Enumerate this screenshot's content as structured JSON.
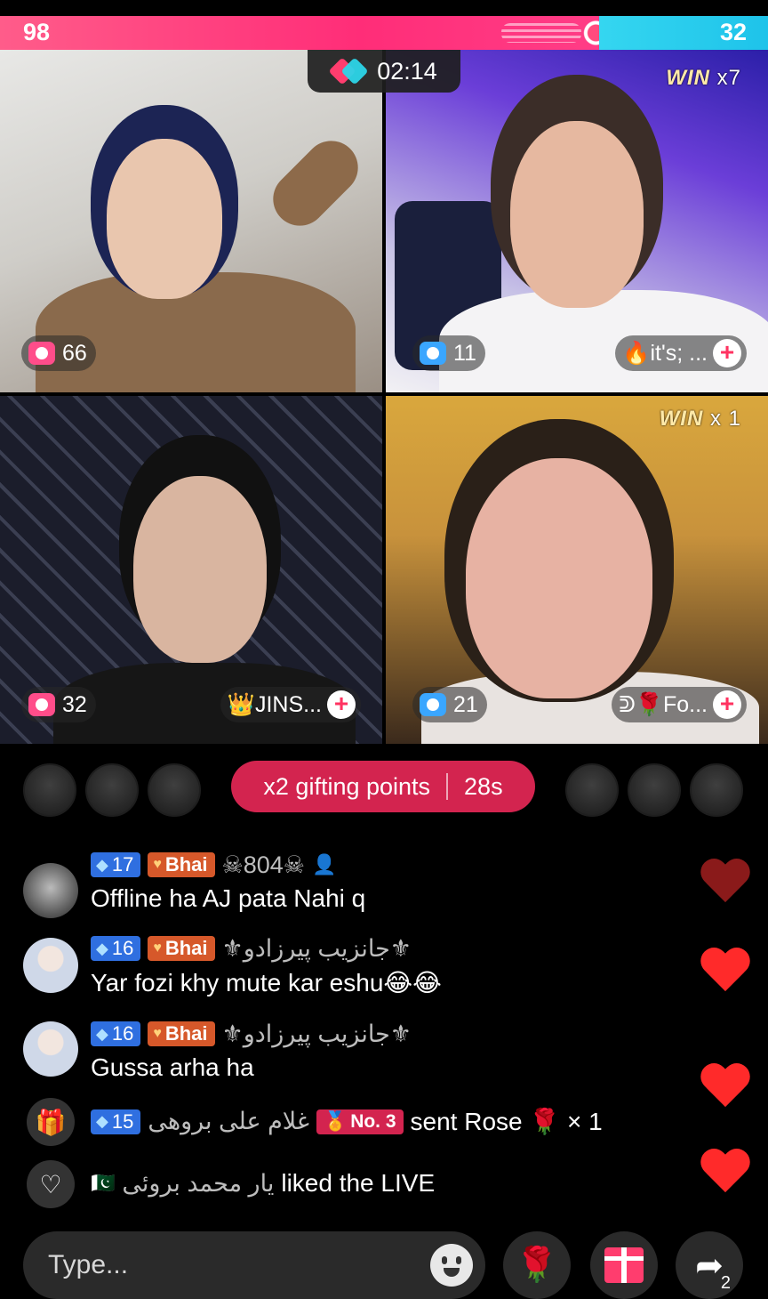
{
  "battle": {
    "left_score": "98",
    "right_score": "32",
    "left_share": 0.78,
    "timer": "02:14"
  },
  "tiles": [
    {
      "score": "66",
      "score_icon_color": "#ff4d8a",
      "win_badge": null,
      "name": null
    },
    {
      "score": "11",
      "score_icon_color": "#3aa6ff",
      "win_badge": {
        "label": "WIN",
        "count": "x7"
      },
      "name": "🔥it's; ..."
    },
    {
      "score": "32",
      "score_icon_color": "#ff4d8a",
      "win_badge": null,
      "name": "👑JINS..."
    },
    {
      "score": "21",
      "score_icon_color": "#3aa6ff",
      "win_badge": {
        "label": "WIN",
        "count": "x 1"
      },
      "name": "ᕲ🌹Fo..."
    }
  ],
  "gifting": {
    "label": "x2 gifting points",
    "countdown": "28s"
  },
  "chat": [
    {
      "level": "17",
      "tag": "Bhai",
      "username": "☠804☠",
      "text": "Offline ha AJ pata Nahi q"
    },
    {
      "level": "16",
      "tag": "Bhai",
      "username": "⚜جانزیب پیرزادو⚜",
      "text": "Yar fozi khy mute kar eshu😂😂"
    },
    {
      "level": "16",
      "tag": "Bhai",
      "username": "⚜جانزیب پیرزادو⚜",
      "text": "Gussa arha ha"
    }
  ],
  "events": {
    "gift": {
      "level": "15",
      "username": "غلام علی بروهی",
      "rank": "No. 3",
      "action": "sent Rose 🌹 × 1"
    },
    "like": {
      "flag": "🇵🇰",
      "username": "یار محمد بروئی",
      "action": "liked the LIVE"
    }
  },
  "composer": {
    "placeholder": "Type...",
    "share_count": "2"
  },
  "colors": {
    "team_red": "#ff2d78",
    "team_blue": "#1ec3ea",
    "gift_pill": "#d3244f",
    "heart": "#ff2a2a"
  }
}
